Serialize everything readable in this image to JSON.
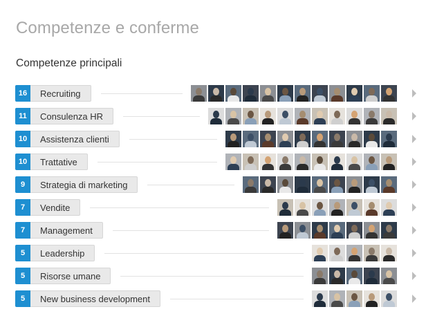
{
  "header": {
    "title": "Competenze e conferme",
    "subtitle": "Competenze principali"
  },
  "colors": {
    "count_badge": "#1e8fd1",
    "title": "#a8a8a8",
    "pill_bg": "#e9e9e9"
  },
  "skills": [
    {
      "count": "16",
      "name": "Recruiting",
      "endorsers": 12
    },
    {
      "count": "11",
      "name": "Consulenza HR",
      "endorsers": 11
    },
    {
      "count": "10",
      "name": "Assistenza clienti",
      "endorsers": 10
    },
    {
      "count": "10",
      "name": "Trattative",
      "endorsers": 10
    },
    {
      "count": "9",
      "name": "Strategia di marketing",
      "endorsers": 9
    },
    {
      "count": "7",
      "name": "Vendite",
      "endorsers": 7
    },
    {
      "count": "7",
      "name": "Management",
      "endorsers": 7
    },
    {
      "count": "5",
      "name": "Leadership",
      "endorsers": 5
    },
    {
      "count": "5",
      "name": "Risorse umane",
      "endorsers": 5
    },
    {
      "count": "5",
      "name": "New business development",
      "endorsers": 5
    }
  ]
}
